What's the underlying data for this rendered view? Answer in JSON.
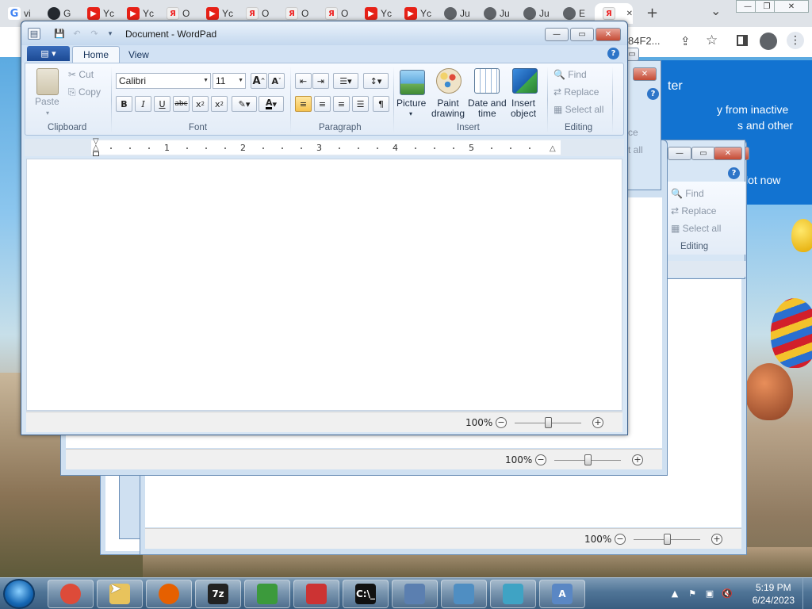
{
  "chrome": {
    "tabs": [
      {
        "icon": "google-icon",
        "short": "vi",
        "glyph": "G",
        "cls": "g"
      },
      {
        "icon": "github-icon",
        "short": "G",
        "glyph": "",
        "cls": "gh"
      },
      {
        "icon": "youtube-icon",
        "short": "Yc",
        "glyph": "▶",
        "cls": "yt"
      },
      {
        "icon": "youtube-icon",
        "short": "Yc",
        "glyph": "▶",
        "cls": "yt"
      },
      {
        "icon": "yandex-icon",
        "short": "O",
        "glyph": "Я",
        "cls": "ya"
      },
      {
        "icon": "youtube-icon",
        "short": "Yc",
        "glyph": "▶",
        "cls": "yt"
      },
      {
        "icon": "yandex-icon",
        "short": "O",
        "glyph": "Я",
        "cls": "ya"
      },
      {
        "icon": "yandex-icon",
        "short": "O",
        "glyph": "Я",
        "cls": "ya"
      },
      {
        "icon": "yandex-icon",
        "short": "O",
        "glyph": "Я",
        "cls": "ya"
      },
      {
        "icon": "youtube-icon",
        "short": "Yc",
        "glyph": "▶",
        "cls": "yt"
      },
      {
        "icon": "youtube-icon",
        "short": "Yc",
        "glyph": "▶",
        "cls": "yt"
      },
      {
        "icon": "globe-icon",
        "short": "Ju",
        "glyph": "",
        "cls": "gl"
      },
      {
        "icon": "globe-icon",
        "short": "Ju",
        "glyph": "",
        "cls": "gl"
      },
      {
        "icon": "globe-icon",
        "short": "Ju",
        "glyph": "",
        "cls": "gl"
      },
      {
        "icon": "globe-icon",
        "short": "E",
        "glyph": "",
        "cls": "ex"
      },
      {
        "icon": "yandex-icon",
        "short": "",
        "glyph": "Я",
        "cls": "ya"
      }
    ],
    "url_fragment": "84F2...",
    "new_tab": "+",
    "tab_search": "⌄"
  },
  "banner": {
    "title": "ter",
    "line1": "y from inactive",
    "line2": "s and other",
    "button": "lot now"
  },
  "bgwin1": {
    "edit_labels": [
      "ce",
      "t all"
    ]
  },
  "bgwin2": {
    "find": "Find",
    "replace": "Replace",
    "select_all": "Select all",
    "editing": "Editing",
    "zoom": "100%"
  },
  "bgwin3": {
    "zoom": "100%"
  },
  "bgwin4": {
    "zoom": "100%"
  },
  "wordpad": {
    "title": "Document - WordPad",
    "tabs": {
      "home": "Home",
      "view": "View"
    },
    "help": "?",
    "clipboard": {
      "paste": "Paste",
      "cut": "Cut",
      "copy": "Copy",
      "label": "Clipboard"
    },
    "font": {
      "family": "Calibri",
      "size": "11",
      "grow": "A",
      "shrink": "A",
      "bold": "B",
      "italic": "I",
      "underline": "U",
      "strike": "abc",
      "subscript": "x",
      "superscript": "x",
      "label": "Font"
    },
    "paragraph": {
      "label": "Paragraph"
    },
    "insert": {
      "picture": "Picture",
      "paint1": "Paint",
      "paint2": "drawing",
      "date1": "Date and",
      "date2": "time",
      "obj1": "Insert",
      "obj2": "object",
      "label": "Insert"
    },
    "editing": {
      "find": "Find",
      "replace": "Replace",
      "select_all": "Select all",
      "label": "Editing"
    },
    "ruler": [
      "1",
      "2",
      "3",
      "4",
      "5"
    ],
    "zoom": "100%"
  },
  "taskbar": {
    "apps": [
      {
        "icon": "chrome-icon",
        "glyph": "",
        "color": "#dd4b39"
      },
      {
        "icon": "file-explorer-icon",
        "glyph": "",
        "color": "#e8c35c"
      },
      {
        "icon": "firefox-icon",
        "glyph": "",
        "color": "#e66000"
      },
      {
        "icon": "7zip-icon",
        "glyph": "7z",
        "color": "#222222"
      },
      {
        "icon": "vm-icon",
        "glyph": "",
        "color": "#3c9a3c"
      },
      {
        "icon": "cube-app-icon",
        "glyph": "",
        "color": "#c33"
      },
      {
        "icon": "terminal-icon",
        "glyph": "C:\\_",
        "color": "#111111"
      },
      {
        "icon": "keyboard-icon",
        "glyph": "",
        "color": "#5b7fb0"
      },
      {
        "icon": "image-viewer-icon",
        "glyph": "",
        "color": "#4f8ec2"
      },
      {
        "icon": "puzzle-app-icon",
        "glyph": "",
        "color": "#3fa3c4"
      },
      {
        "icon": "wordpad-icon",
        "glyph": "A",
        "color": "#5a87c4"
      }
    ],
    "time": "5:19 PM",
    "date": "6/24/2023"
  }
}
